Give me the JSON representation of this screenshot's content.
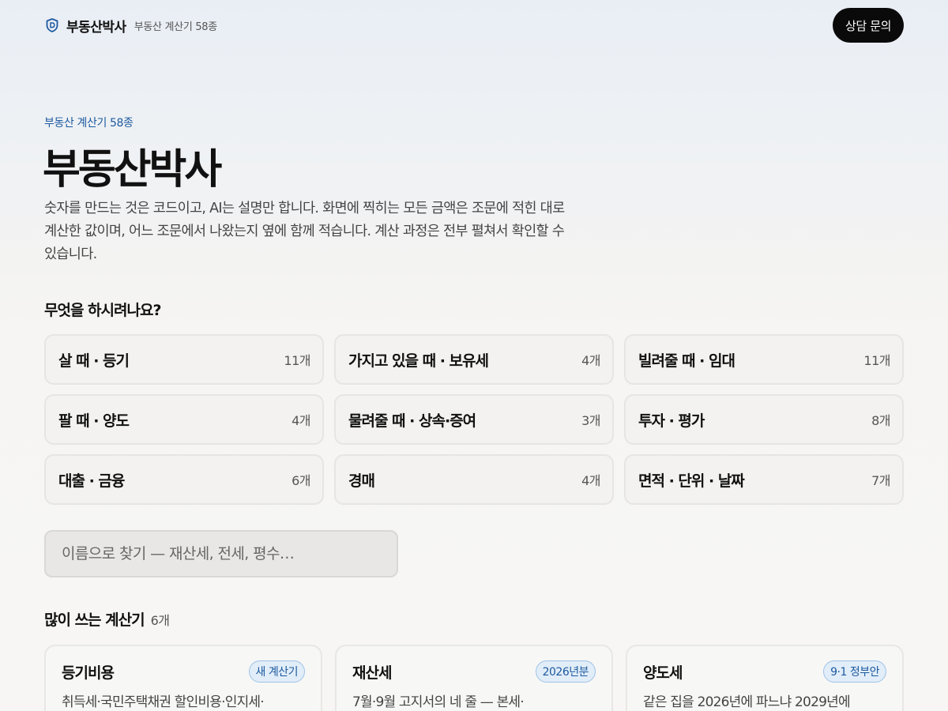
{
  "header": {
    "brand_name": "부동산박사",
    "brand_sub": "부동산 계산기 58종",
    "contact_label": "상담 문의"
  },
  "hero": {
    "eyebrow": "부동산 계산기 58종",
    "title": "부동산박사",
    "description": "숫자를 만드는 것은 코드이고, AI는 설명만 합니다. 화면에 찍히는 모든 금액은 조문에 적힌 대로 계산한 값이며, 어느 조문에서 나왔는지 옆에 함께 적습니다. 계산 과정은 전부 펼쳐서 확인할 수 있습니다."
  },
  "categories": {
    "heading": "무엇을 하시려나요?",
    "items": [
      {
        "label": "살 때 · 등기",
        "count": "11개"
      },
      {
        "label": "가지고 있을 때 · 보유세",
        "count": "4개"
      },
      {
        "label": "빌려줄 때 · 임대",
        "count": "11개"
      },
      {
        "label": "팔 때 · 양도",
        "count": "4개"
      },
      {
        "label": "물려줄 때 · 상속·증여",
        "count": "3개"
      },
      {
        "label": "투자 · 평가",
        "count": "8개"
      },
      {
        "label": "대출 · 금융",
        "count": "6개"
      },
      {
        "label": "경매",
        "count": "4개"
      },
      {
        "label": "면적 · 단위 · 날짜",
        "count": "7개"
      }
    ]
  },
  "search": {
    "placeholder": "이름으로 찾기 — 재산세, 전세, 평수…"
  },
  "popular": {
    "title": "많이 쓰는 계산기",
    "count": "6개",
    "items": [
      {
        "title": "등기비용",
        "badge": "새 계산기",
        "desc": "취득세·국민주택채권 할인비용·인지세·"
      },
      {
        "title": "재산세",
        "badge": "2026년분",
        "desc": "7월·9월 고지서의 네 줄 — 본세·"
      },
      {
        "title": "양도세",
        "badge": "9·1 정부안",
        "desc": "같은 집을 2026년에 파느냐 2029년에"
      }
    ]
  },
  "colors": {
    "accent": "#1d5aa0",
    "badge_bg": "#e1edf8",
    "button_bg": "#0a0a0a"
  }
}
